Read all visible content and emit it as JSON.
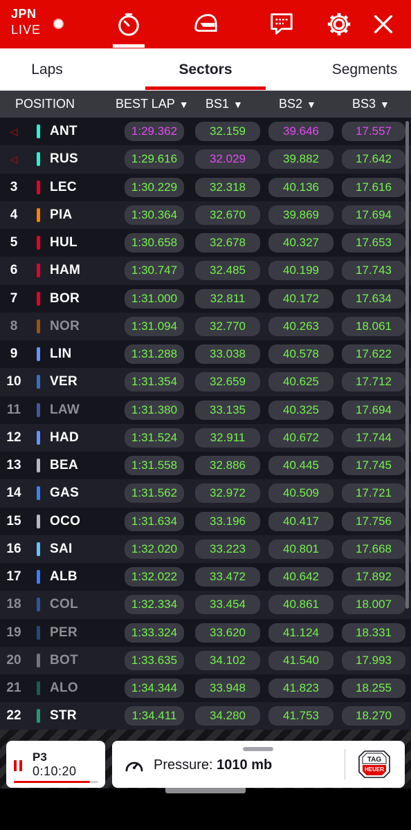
{
  "header": {
    "event_code": "JPN",
    "live_label": "LIVE",
    "icons": [
      "stopwatch-icon",
      "helmet-icon",
      "chat-icon",
      "gear-icon",
      "close-icon"
    ]
  },
  "tabs": [
    {
      "label": "Laps",
      "active": false
    },
    {
      "label": "Sectors",
      "active": true
    },
    {
      "label": "Segments",
      "active": false
    }
  ],
  "columns": {
    "position": "POSITION",
    "best_lap": "BEST LAP",
    "bs1": "BS1",
    "bs2": "BS2",
    "bs3": "BS3"
  },
  "colors": {
    "accent": "#e10600",
    "green": "#74f24c",
    "purple": "#e04bf0"
  },
  "rows": [
    {
      "pos": "◁",
      "driver": "ANT",
      "team_color": "#27f4d2",
      "dim": false,
      "best_lap": "1:29.362",
      "bs1": "32.159",
      "bs2": "39.646",
      "bs3": "17.557",
      "best_lap_color": "purple",
      "bs1_color": "green",
      "bs2_color": "purple",
      "bs3_color": "purple"
    },
    {
      "pos": "◁",
      "driver": "RUS",
      "team_color": "#27f4d2",
      "dim": false,
      "best_lap": "1:29.616",
      "bs1": "32.029",
      "bs2": "39.882",
      "bs3": "17.642",
      "best_lap_color": "green",
      "bs1_color": "purple",
      "bs2_color": "green",
      "bs3_color": "green"
    },
    {
      "pos": "3",
      "driver": "LEC",
      "team_color": "#e8002d",
      "dim": false,
      "best_lap": "1:30.229",
      "bs1": "32.318",
      "bs2": "40.136",
      "bs3": "17.616"
    },
    {
      "pos": "4",
      "driver": "PIA",
      "team_color": "#ff8000",
      "dim": false,
      "best_lap": "1:30.364",
      "bs1": "32.670",
      "bs2": "39.869",
      "bs3": "17.694"
    },
    {
      "pos": "5",
      "driver": "HUL",
      "team_color": "#e8002d",
      "dim": false,
      "best_lap": "1:30.658",
      "bs1": "32.678",
      "bs2": "40.327",
      "bs3": "17.653"
    },
    {
      "pos": "6",
      "driver": "HAM",
      "team_color": "#e8002d",
      "dim": false,
      "best_lap": "1:30.747",
      "bs1": "32.485",
      "bs2": "40.199",
      "bs3": "17.743"
    },
    {
      "pos": "7",
      "driver": "BOR",
      "team_color": "#e8002d",
      "dim": false,
      "best_lap": "1:31.000",
      "bs1": "32.811",
      "bs2": "40.172",
      "bs3": "17.634"
    },
    {
      "pos": "8",
      "driver": "NOR",
      "team_color": "#ff8000",
      "dim": true,
      "best_lap": "1:31.094",
      "bs1": "32.770",
      "bs2": "40.263",
      "bs3": "18.061"
    },
    {
      "pos": "9",
      "driver": "LIN",
      "team_color": "#6692ff",
      "dim": false,
      "best_lap": "1:31.288",
      "bs1": "33.038",
      "bs2": "40.578",
      "bs3": "17.622"
    },
    {
      "pos": "10",
      "driver": "VER",
      "team_color": "#3671c6",
      "dim": false,
      "best_lap": "1:31.354",
      "bs1": "32.659",
      "bs2": "40.625",
      "bs3": "17.712"
    },
    {
      "pos": "11",
      "driver": "LAW",
      "team_color": "#6692ff",
      "dim": true,
      "best_lap": "1:31.380",
      "bs1": "33.135",
      "bs2": "40.325",
      "bs3": "17.694"
    },
    {
      "pos": "12",
      "driver": "HAD",
      "team_color": "#6692ff",
      "dim": false,
      "best_lap": "1:31.524",
      "bs1": "32.911",
      "bs2": "40.672",
      "bs3": "17.744"
    },
    {
      "pos": "13",
      "driver": "BEA",
      "team_color": "#b6babd",
      "dim": false,
      "best_lap": "1:31.558",
      "bs1": "32.886",
      "bs2": "40.445",
      "bs3": "17.745"
    },
    {
      "pos": "14",
      "driver": "GAS",
      "team_color": "#3b82f6",
      "dim": false,
      "best_lap": "1:31.562",
      "bs1": "32.972",
      "bs2": "40.509",
      "bs3": "17.721"
    },
    {
      "pos": "15",
      "driver": "OCO",
      "team_color": "#b6babd",
      "dim": false,
      "best_lap": "1:31.634",
      "bs1": "33.196",
      "bs2": "40.417",
      "bs3": "17.756"
    },
    {
      "pos": "16",
      "driver": "SAI",
      "team_color": "#64c4ff",
      "dim": false,
      "best_lap": "1:32.020",
      "bs1": "33.223",
      "bs2": "40.801",
      "bs3": "17.668"
    },
    {
      "pos": "17",
      "driver": "ALB",
      "team_color": "#3b7bff",
      "dim": false,
      "best_lap": "1:32.022",
      "bs1": "33.472",
      "bs2": "40.642",
      "bs3": "17.892"
    },
    {
      "pos": "18",
      "driver": "COL",
      "team_color": "#3b82f6",
      "dim": true,
      "best_lap": "1:32.334",
      "bs1": "33.454",
      "bs2": "40.861",
      "bs3": "18.007"
    },
    {
      "pos": "19",
      "driver": "PER",
      "team_color": "#3671c6",
      "dim": true,
      "best_lap": "1:33.324",
      "bs1": "33.620",
      "bs2": "41.124",
      "bs3": "18.331"
    },
    {
      "pos": "20",
      "driver": "BOT",
      "team_color": "#b6babd",
      "dim": true,
      "best_lap": "1:33.635",
      "bs1": "34.102",
      "bs2": "41.540",
      "bs3": "17.993"
    },
    {
      "pos": "21",
      "driver": "ALO",
      "team_color": "#229971",
      "dim": true,
      "best_lap": "1:34.344",
      "bs1": "33.948",
      "bs2": "41.823",
      "bs3": "18.255"
    },
    {
      "pos": "22",
      "driver": "STR",
      "team_color": "#229971",
      "dim": false,
      "best_lap": "1:34.411",
      "bs1": "34.280",
      "bs2": "41.753",
      "bs3": "18.270"
    }
  ],
  "footer": {
    "position_label": "P3",
    "session_time": "0:10:20",
    "progress_fraction": 0.9,
    "pressure_label": "Pressure:",
    "pressure_value": "1010 mb",
    "sponsor_line1": "TAG",
    "sponsor_line2": "HEUER"
  }
}
